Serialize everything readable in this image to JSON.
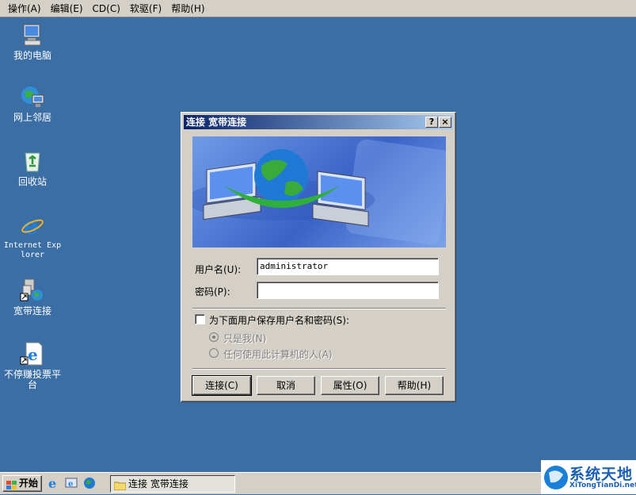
{
  "menu": [
    "操作(A)",
    "编辑(E)",
    "CD(C)",
    "软驱(F)",
    "帮助(H)"
  ],
  "desktop": {
    "icons": [
      {
        "label": "我的电脑",
        "icon": "computer-icon"
      },
      {
        "label": "网上邻居",
        "icon": "network-icon"
      },
      {
        "label": "回收站",
        "icon": "recycle-bin-icon"
      },
      {
        "label": "Internet Explorer",
        "icon": "internet-explorer-icon"
      },
      {
        "label": "宽带连接",
        "icon": "broadband-connection-icon"
      },
      {
        "label": "不停赚投票平台",
        "icon": "web-shortcut-icon"
      }
    ]
  },
  "dialog": {
    "title": "连接 宽带连接",
    "help_btn": "?",
    "close_btn": "×",
    "username_label": "用户名(U):",
    "username_value": "administrator",
    "password_label": "密码(P):",
    "password_value": "",
    "save_label": "为下面用户保存用户名和密码(S):",
    "radio_me": "只是我(N)",
    "radio_anyone": "任何使用此计算机的人(A)",
    "buttons": {
      "connect": "连接(C)",
      "cancel": "取消",
      "properties": "属性(O)",
      "help": "帮助(H)"
    }
  },
  "taskbar": {
    "start": "开始",
    "task": "连接 宽带连接"
  },
  "watermark": {
    "title": "系统天地",
    "url": "XiTongTianDi.net"
  },
  "colors": {
    "desktop": "#3a6ea5",
    "titlebar_start": "#0a246a",
    "titlebar_end": "#a6caf0",
    "face": "#d4d0c8"
  }
}
